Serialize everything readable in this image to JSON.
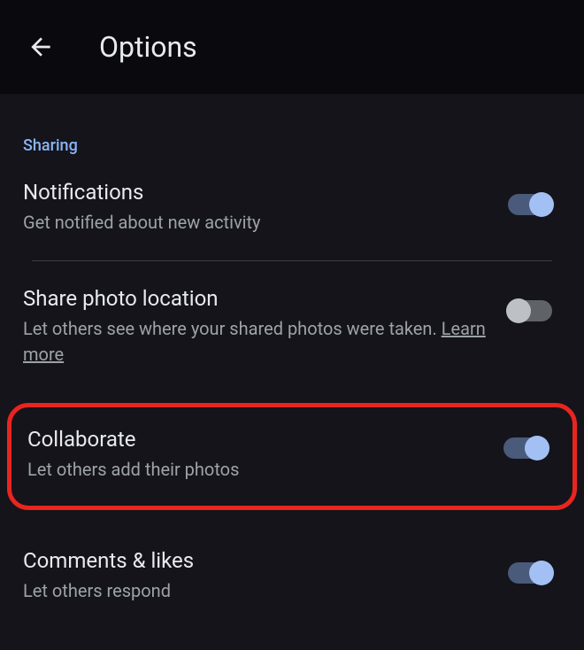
{
  "header": {
    "title": "Options"
  },
  "section": {
    "label": "Sharing"
  },
  "settings": {
    "notifications": {
      "title": "Notifications",
      "description": "Get notified about new activity",
      "enabled": true
    },
    "photoLocation": {
      "title": "Share photo location",
      "description": "Let others see where your shared photos were taken. ",
      "learnMore": "Learn more",
      "enabled": false
    },
    "collaborate": {
      "title": "Collaborate",
      "description": "Let others add their photos",
      "enabled": true
    },
    "commentsLikes": {
      "title": "Comments & likes",
      "description": "Let others respond",
      "enabled": true
    }
  }
}
